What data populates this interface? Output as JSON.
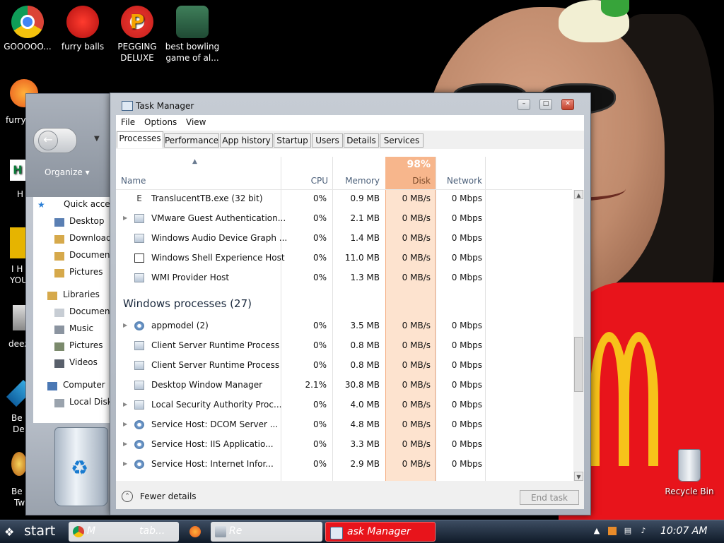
{
  "desktop": {
    "top_icons": [
      {
        "label": "GOOOOO..."
      },
      {
        "label": "furry balls"
      },
      {
        "label": "PEGGING DELUXE"
      },
      {
        "label": "best bowling game of al..."
      }
    ],
    "left_partial": [
      "furry",
      "H",
      "I H",
      "YOU",
      "deez",
      "Be",
      "De",
      "Be",
      "Tw"
    ],
    "recycle_bin": "Recycle Bin"
  },
  "explorer": {
    "organize": "Organize",
    "nav": [
      {
        "label": "Quick acces"
      },
      {
        "label": "Desktop"
      },
      {
        "label": "Downloads"
      },
      {
        "label": "Documents"
      },
      {
        "label": "Pictures"
      },
      {
        "label": "Libraries"
      },
      {
        "label": "Documents"
      },
      {
        "label": "Music"
      },
      {
        "label": "Pictures"
      },
      {
        "label": "Videos"
      },
      {
        "label": "Computer"
      },
      {
        "label": "Local Disk"
      }
    ]
  },
  "task_manager": {
    "title": "Task Manager",
    "menu": [
      "File",
      "Options",
      "View"
    ],
    "tabs": [
      "Processes",
      "Performance",
      "App history",
      "Startup",
      "Users",
      "Details",
      "Services"
    ],
    "active_tab": "Processes",
    "columns": {
      "name": "Name",
      "cpu": "CPU",
      "memory": "Memory",
      "disk": "Disk",
      "network": "Network"
    },
    "disk_usage": "98%",
    "rows_top": [
      {
        "name": "TranslucentTB.exe (32 bit)",
        "cpu": "0%",
        "memory": "0.9 MB",
        "disk": "0 MB/s",
        "network": "0 Mbps"
      },
      {
        "name": "VMware Guest Authentication...",
        "cpu": "0%",
        "memory": "2.1 MB",
        "disk": "0 MB/s",
        "network": "0 Mbps"
      },
      {
        "name": "Windows Audio Device Graph ...",
        "cpu": "0%",
        "memory": "1.4 MB",
        "disk": "0 MB/s",
        "network": "0 Mbps"
      },
      {
        "name": "Windows Shell Experience Host",
        "cpu": "0%",
        "memory": "11.0 MB",
        "disk": "0 MB/s",
        "network": "0 Mbps"
      },
      {
        "name": "WMI Provider Host",
        "cpu": "0%",
        "memory": "1.3 MB",
        "disk": "0 MB/s",
        "network": "0 Mbps"
      }
    ],
    "group_label": "Windows processes (27)",
    "rows_windows": [
      {
        "name": "appmodel (2)",
        "cpu": "0%",
        "memory": "3.5 MB",
        "disk": "0 MB/s",
        "network": "0 Mbps"
      },
      {
        "name": "Client Server Runtime Process",
        "cpu": "0%",
        "memory": "0.8 MB",
        "disk": "0 MB/s",
        "network": "0 Mbps"
      },
      {
        "name": "Client Server Runtime Process",
        "cpu": "0%",
        "memory": "0.8 MB",
        "disk": "0 MB/s",
        "network": "0 Mbps"
      },
      {
        "name": "Desktop Window Manager",
        "cpu": "2.1%",
        "memory": "30.8 MB",
        "disk": "0 MB/s",
        "network": "0 Mbps"
      },
      {
        "name": "Local Security Authority Proc...",
        "cpu": "0%",
        "memory": "4.0 MB",
        "disk": "0 MB/s",
        "network": "0 Mbps"
      },
      {
        "name": "Service Host: DCOM Server ...",
        "cpu": "0%",
        "memory": "4.8 MB",
        "disk": "0 MB/s",
        "network": "0 Mbps"
      },
      {
        "name": "Service Host: IIS Applicatio...",
        "cpu": "0%",
        "memory": "3.3 MB",
        "disk": "0 MB/s",
        "network": "0 Mbps"
      },
      {
        "name": "Service Host: Internet Infor...",
        "cpu": "0%",
        "memory": "2.9 MB",
        "disk": "0 MB/s",
        "network": "0 Mbps"
      }
    ],
    "fewer_details": "Fewer details",
    "end_task": "End task"
  },
  "taskbar": {
    "start": "start",
    "items": [
      {
        "label": "M"
      },
      {
        "label": "tab..."
      },
      {
        "label": "Re"
      },
      {
        "label": "ask Manager"
      }
    ],
    "clock": "10:07 AM"
  },
  "colors": {
    "disk_highlight": "#f7b68c",
    "taskbar_active": "#e8141b"
  }
}
